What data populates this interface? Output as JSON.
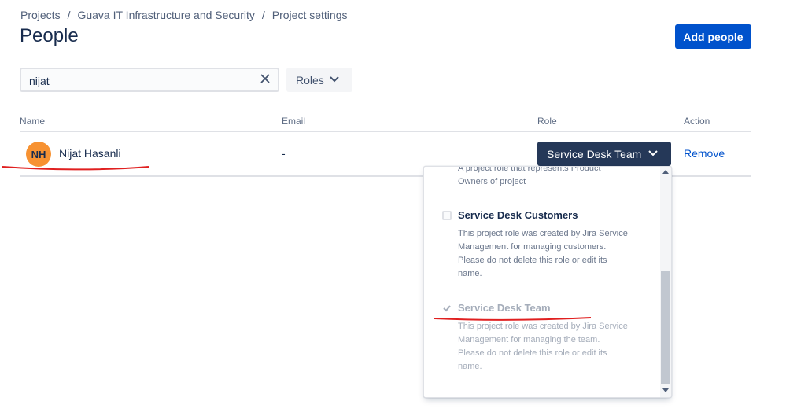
{
  "breadcrumb": {
    "items": [
      "Projects",
      "Guava IT Infrastructure and Security",
      "Project settings"
    ],
    "separator": "/"
  },
  "page": {
    "title": "People"
  },
  "actions": {
    "add_people_label": "Add people"
  },
  "filters": {
    "search_value": "nijat",
    "roles_label": "Roles",
    "clear_icon": "close-icon",
    "roles_icon": "chevron-down-icon"
  },
  "table": {
    "columns": {
      "name": "Name",
      "email": "Email",
      "role": "Role",
      "action": "Action"
    },
    "rows": [
      {
        "initials": "NH",
        "name": "Nijat Hasanli",
        "email": "-",
        "role": "Service Desk Team",
        "action": "Remove"
      }
    ]
  },
  "role_dropdown": {
    "options": [
      {
        "title": "",
        "description_lines": [
          "A project role that represents Product",
          "Owners of project"
        ],
        "checked": false,
        "disabled": false
      },
      {
        "title": "Service Desk Customers",
        "description_lines": [
          "This project role was created by Jira Service",
          "Management for managing customers.",
          "Please do not delete this role or edit its",
          "name."
        ],
        "checked": false,
        "disabled": false
      },
      {
        "title": "Service Desk Team",
        "description_lines": [
          "This project role was created by Jira Service",
          "Management for managing the team.",
          "Please do not delete this role or edit its",
          "name."
        ],
        "checked": true,
        "disabled": true
      }
    ]
  },
  "colors": {
    "primary": "#0052cc",
    "role_button": "#253858",
    "avatar": "#f79232",
    "annotation": "#e02020"
  }
}
